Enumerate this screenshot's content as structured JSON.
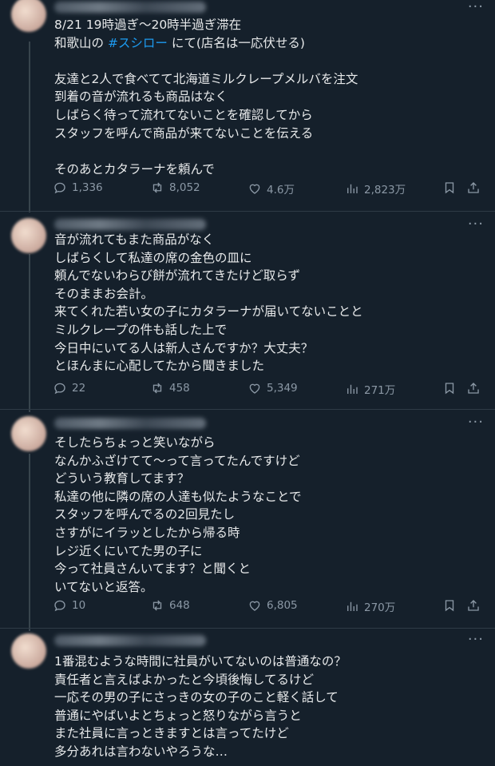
{
  "tweets": [
    {
      "lines": [
        {
          "text": "8/21 19時過ぎ〜20時半過ぎ滞在"
        },
        {
          "prefix": "和歌山の ",
          "hashtag": "#スシロー",
          "suffix": " にて(店名は一応伏せる)"
        },
        {
          "text": ""
        },
        {
          "text": "友達と2人で食べてて北海道ミルクレープメルバを注文"
        },
        {
          "text": "到着の音が流れるも商品はなく"
        },
        {
          "text": "しばらく待って流れてないことを確認してから"
        },
        {
          "text": "スタッフを呼んで商品が来てないことを伝える"
        },
        {
          "text": ""
        },
        {
          "text": "そのあとカタラーナを頼んで"
        }
      ],
      "replies": "1,336",
      "retweets": "8,052",
      "likes": "4.6万",
      "views": "2,823万"
    },
    {
      "lines": [
        {
          "text": "音が流れてもまた商品がなく"
        },
        {
          "text": "しばらくして私達の席の金色の皿に"
        },
        {
          "text": "頼んでないわらび餅が流れてきたけど取らず"
        },
        {
          "text": "そのままお会計。"
        },
        {
          "text": "来てくれた若い女の子にカタラーナが届いてないことと"
        },
        {
          "text": "ミルクレープの件も話した上で"
        },
        {
          "text": "今日中にいてる人は新人さんですか？大丈夫？"
        },
        {
          "text": "とほんまに心配してたから聞きました"
        }
      ],
      "replies": "22",
      "retweets": "458",
      "likes": "5,349",
      "views": "271万"
    },
    {
      "lines": [
        {
          "text": "そしたらちょっと笑いながら"
        },
        {
          "text": "なんかふざけてて〜って言ってたんですけど"
        },
        {
          "text": "どういう教育してます？"
        },
        {
          "text": "私達の他に隣の席の人達も似たようなことで"
        },
        {
          "text": "スタッフを呼んでるの2回見たし"
        },
        {
          "text": "さすがにイラッとしたから帰る時"
        },
        {
          "text": "レジ近くにいてた男の子に"
        },
        {
          "text": "今って社員さんいてます？と聞くと"
        },
        {
          "text": "いてないと返答。"
        }
      ],
      "replies": "10",
      "retweets": "648",
      "likes": "6,805",
      "views": "270万"
    },
    {
      "lines": [
        {
          "text": "1番混むような時間に社員がいてないのは普通なの？"
        },
        {
          "text": "責任者と言えばよかったと今頃後悔してるけど"
        },
        {
          "text": "一応その男の子にさっきの女の子のこと軽く話して"
        },
        {
          "text": "普通にやばいよとちょっと怒りながら言うと"
        },
        {
          "text": "また社員に言っときますとは言ってたけど"
        },
        {
          "text": "多分あれは言わないやろうな…"
        }
      ]
    }
  ],
  "more_label": "···",
  "colors": {
    "background": "#15202b",
    "hashtag": "#1d9bf0",
    "muted": "#8b98a5"
  }
}
